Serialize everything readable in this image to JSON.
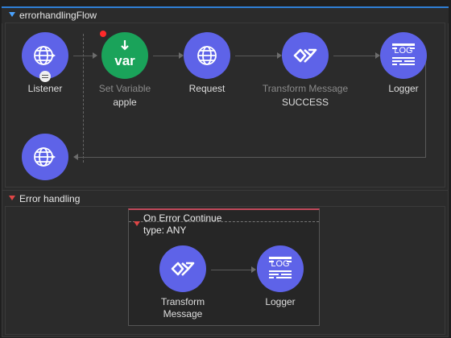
{
  "flow": {
    "title": "errorhandlingFlow"
  },
  "nodes": {
    "listener": {
      "label": "Listener",
      "icon": "globe-icon"
    },
    "set_variable": {
      "label": "Set Variable",
      "sub": "apple",
      "icon_text": "var",
      "icon": "download-arrow-icon"
    },
    "request": {
      "label": "Request",
      "icon": "globe-icon"
    },
    "transform": {
      "label": "Transform Message",
      "sub": "SUCCESS",
      "icon": "transform-icon"
    },
    "logger": {
      "label": "Logger",
      "icon_text": "LOG",
      "icon": "log-icon"
    },
    "source_response": {
      "icon": "globe-icon"
    }
  },
  "error_handling": {
    "title": "Error handling",
    "scope": {
      "title": "On Error Continue",
      "type": "type: ANY",
      "transform_label_1": "Transform",
      "transform_label_2": "Message",
      "logger_label": "Logger",
      "logger_icon_text": "LOG"
    }
  },
  "colors": {
    "node_purple": "#5e63e8",
    "node_green": "#1aa35a",
    "accent_blue": "#2f7fd6",
    "error_red": "#e04646"
  }
}
